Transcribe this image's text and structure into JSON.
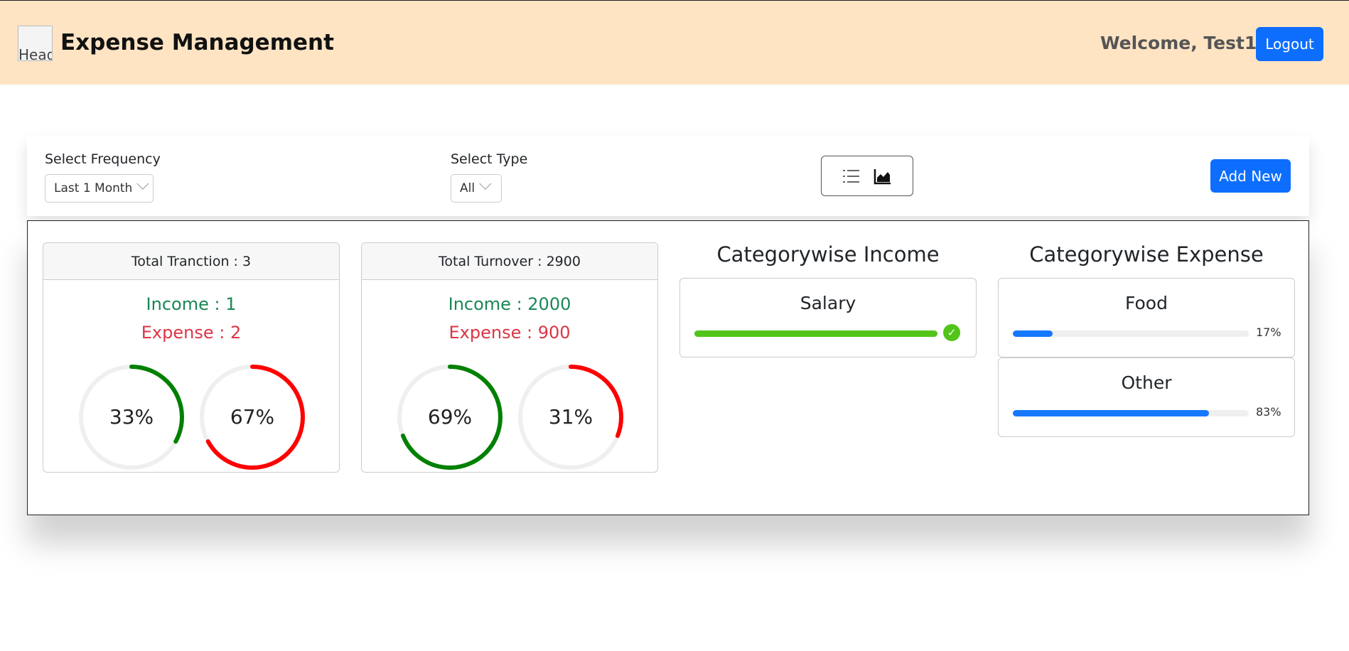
{
  "header": {
    "logo_alt": "Head",
    "title": "Expense Management",
    "welcome": "Welcome, Test1",
    "logout_label": "Logout"
  },
  "filters": {
    "frequency_label": "Select Frequency",
    "frequency_value": "Last 1 Month",
    "type_label": "Select Type",
    "type_value": "All",
    "add_new_label": "Add New"
  },
  "summary": {
    "transactions": {
      "header": "Total Tranction : 3",
      "income": "Income : 1",
      "expense": "Expense : 2",
      "income_pct_label": "33%",
      "expense_pct_label": "67%",
      "income_pct": 33,
      "expense_pct": 67
    },
    "turnover": {
      "header": "Total Turnover : 2900",
      "income": "Income : 2000",
      "expense": "Expense : 900",
      "income_pct_label": "69%",
      "expense_pct_label": "31%",
      "income_pct": 69,
      "expense_pct": 31
    }
  },
  "categorywise_income": {
    "title": "Categorywise Income",
    "items": [
      {
        "name": "Salary",
        "percent": 100,
        "complete": true
      }
    ]
  },
  "categorywise_expense": {
    "title": "Categorywise Expense",
    "items": [
      {
        "name": "Food",
        "percent": 17,
        "label": "17%"
      },
      {
        "name": "Other",
        "percent": 83,
        "label": "83%"
      }
    ]
  },
  "colors": {
    "income": "#008000",
    "expense": "#ff0000",
    "ring_track": "#efefef",
    "progress_blue": "#1677ff",
    "progress_green": "#52c41a",
    "header_bg": "#ffe4c4",
    "primary": "#0d6efd"
  }
}
